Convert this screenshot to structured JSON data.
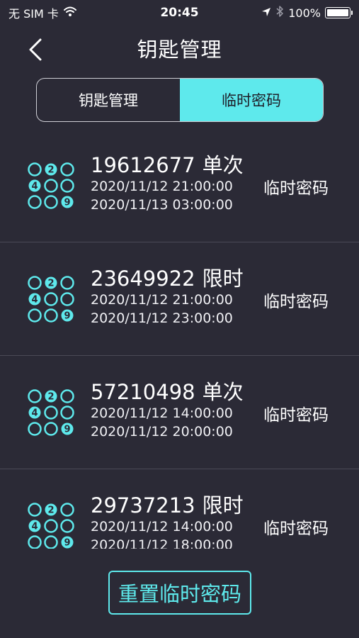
{
  "status_bar": {
    "carrier": "无 SIM 卡",
    "time": "20:45",
    "battery": "100%",
    "battery_level": 1.0,
    "icons": [
      "wifi-icon",
      "location-arrow-icon",
      "bluetooth-icon",
      "battery-icon"
    ]
  },
  "nav": {
    "title": "钥匙管理",
    "back_icon": "chevron-left-icon"
  },
  "tabs": [
    {
      "label": "钥匙管理",
      "selected": false
    },
    {
      "label": "临时密码",
      "selected": true
    }
  ],
  "passwords": [
    {
      "code": "19612677",
      "type": "单次",
      "start": "2020/11/12 21:00:00",
      "end": "2020/11/13 03:00:00",
      "action": "临时密码"
    },
    {
      "code": "23649922",
      "type": "限时",
      "start": "2020/11/12 21:00:00",
      "end": "2020/11/12 23:00:00",
      "action": "临时密码"
    },
    {
      "code": "57210498",
      "type": "单次",
      "start": "2020/11/12 14:00:00",
      "end": "2020/11/12 20:00:00",
      "action": "临时密码"
    },
    {
      "code": "29737213",
      "type": "限时",
      "start": "2020/11/12 14:00:00",
      "end": "2020/11/12 18:00:00",
      "action": "临时密码"
    }
  ],
  "keypad_icon": {
    "name": "keypad-icon",
    "digits": [
      "2",
      "4",
      "9"
    ],
    "color": "#5ee9ec"
  },
  "reset_button": {
    "label": "重置临时密码"
  },
  "colors": {
    "background": "#2b2a36",
    "accent": "#5ee9ec",
    "divider": "#4a4956"
  }
}
